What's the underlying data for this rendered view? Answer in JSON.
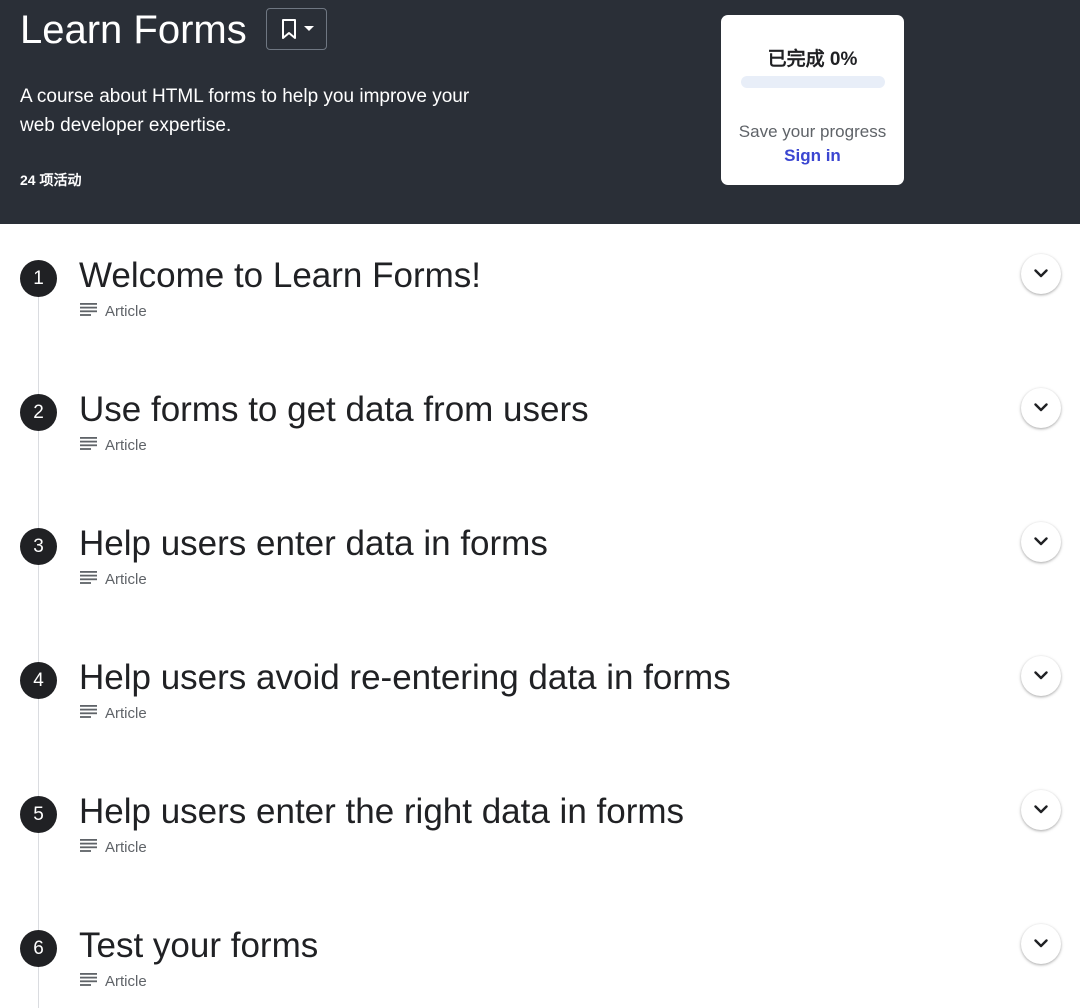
{
  "course": {
    "title": "Learn Forms",
    "description": "A course about HTML forms to help you improve your web developer expertise.",
    "activity_count": "24 项活动"
  },
  "bookmark": {
    "icon": "bookmark-icon",
    "dropdown_icon": "caret-down-icon"
  },
  "progress": {
    "title": "已完成 0%",
    "value": 0,
    "save_text": "Save your progress",
    "signin_label": "Sign in"
  },
  "modules": [
    {
      "number": "1",
      "title": "Welcome to Learn Forms!",
      "type": "Article"
    },
    {
      "number": "2",
      "title": "Use forms to get data from users",
      "type": "Article"
    },
    {
      "number": "3",
      "title": "Help users enter data in forms",
      "type": "Article"
    },
    {
      "number": "4",
      "title": "Help users avoid re-entering data in forms",
      "type": "Article"
    },
    {
      "number": "5",
      "title": "Help users enter the right data in forms",
      "type": "Article"
    },
    {
      "number": "6",
      "title": "Test your forms",
      "type": "Article"
    }
  ],
  "colors": {
    "hero_bg": "#2a2f37",
    "accent": "#3b46d1",
    "number_badge": "#202124"
  }
}
